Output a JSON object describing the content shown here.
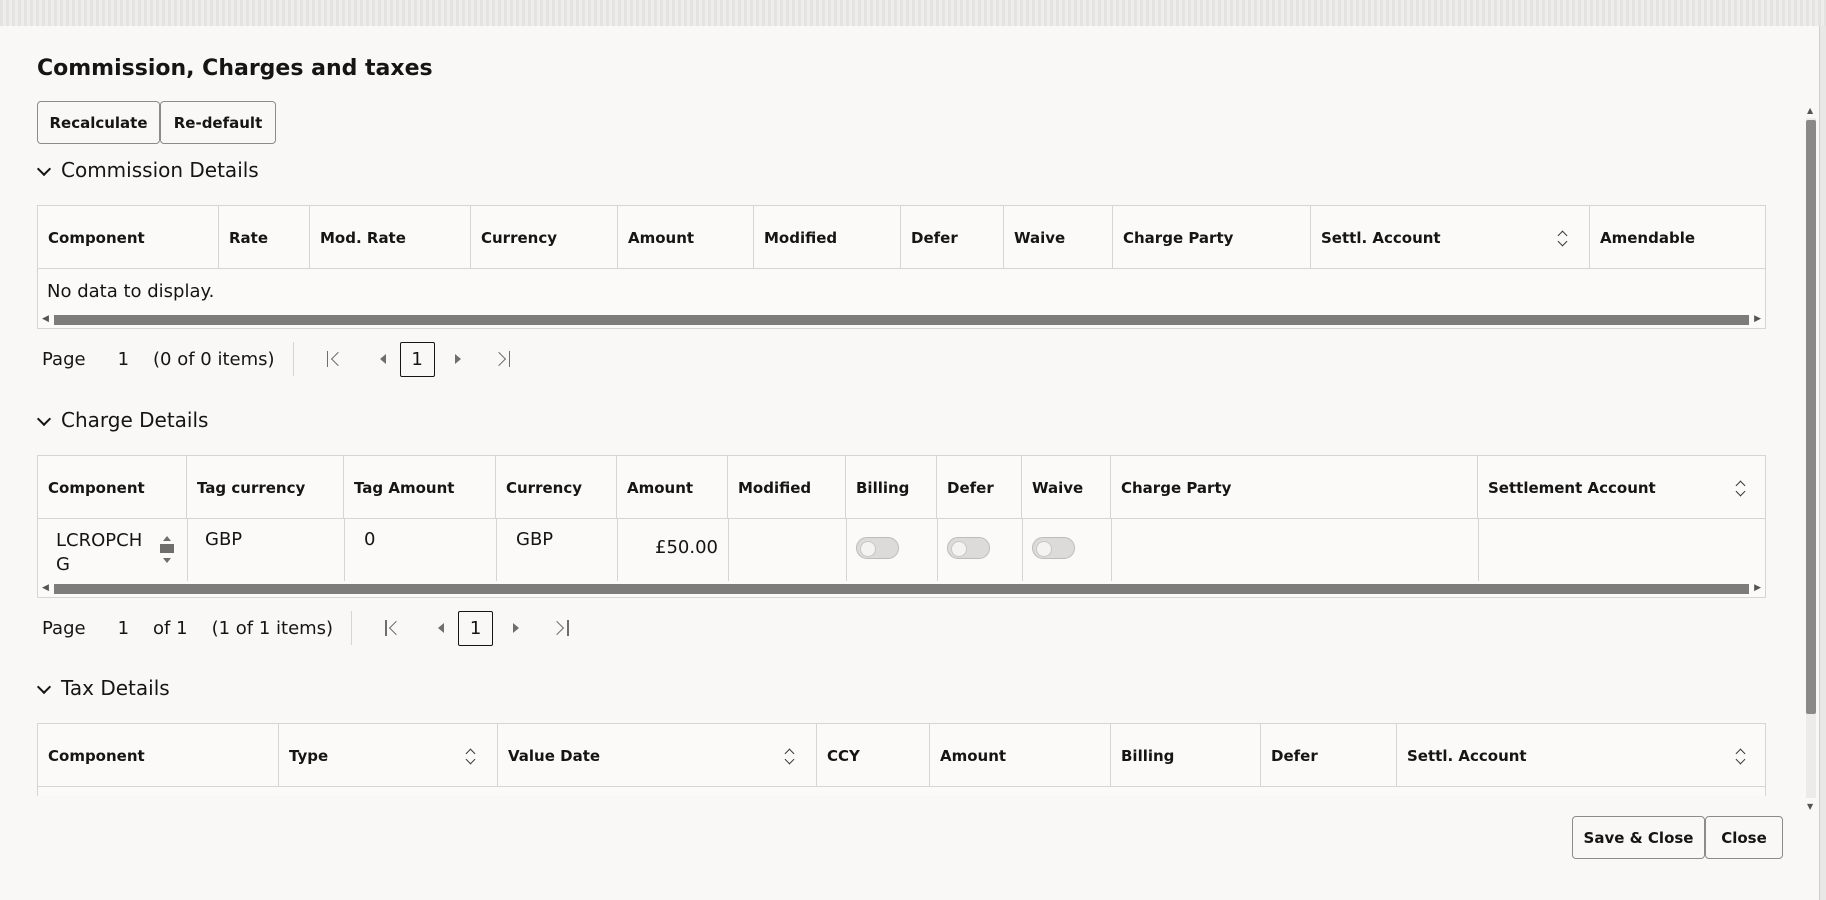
{
  "dialog": {
    "title": "Commission, Charges and taxes",
    "recalculate_label": "Recalculate",
    "redefault_label": "Re-default",
    "save_close_label": "Save & Close",
    "close_label": "Close"
  },
  "commission": {
    "heading": "Commission Details",
    "columns": [
      "Component",
      "Rate",
      "Mod. Rate",
      "Currency",
      "Amount",
      "Modified",
      "Defer",
      "Waive",
      "Charge Party",
      "Settl. Account",
      "Amendable"
    ],
    "empty_text": "No data to display.",
    "pager": {
      "page_label": "Page",
      "page_value": "1",
      "items_text": "(0 of 0 items)",
      "current": "1"
    }
  },
  "charge": {
    "heading": "Charge Details",
    "columns": [
      "Component",
      "Tag currency",
      "Tag Amount",
      "Currency",
      "Amount",
      "Modified",
      "Billing",
      "Defer",
      "Waive",
      "Charge Party",
      "Settlement Account"
    ],
    "rows": [
      {
        "component_line1": "LCROPCH",
        "component_line2": "G",
        "tag_currency": "GBP",
        "tag_amount": "0",
        "currency": "GBP",
        "amount": "£50.00",
        "modified": "",
        "billing": false,
        "defer": false,
        "waive": false,
        "charge_party": "",
        "settlement_account": ""
      }
    ],
    "pager": {
      "page_label": "Page",
      "page_value": "1",
      "of_text": "of 1",
      "items_text": "(1 of 1 items)",
      "current": "1"
    }
  },
  "tax": {
    "heading": "Tax Details",
    "columns": [
      "Component",
      "Type",
      "Value Date",
      "CCY",
      "Amount",
      "Billing",
      "Defer",
      "Settl. Account"
    ]
  },
  "icons": {
    "collapse": "chevron-down-icon",
    "sort": "sort-icon",
    "first": "first-page-icon",
    "prev": "previous-page-icon",
    "next": "next-page-icon",
    "last": "last-page-icon"
  }
}
